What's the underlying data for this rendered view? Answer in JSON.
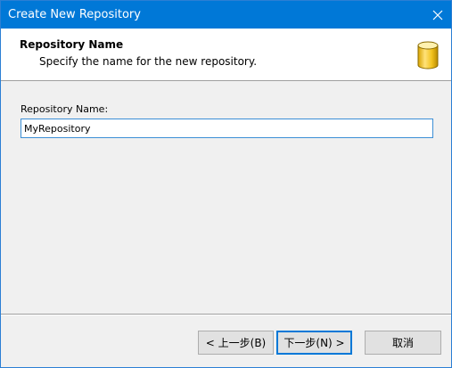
{
  "window": {
    "title": "Create New Repository",
    "title_bar_color": "#0078d7"
  },
  "header": {
    "title": "Repository Name",
    "subtitle": "Specify the name for the new repository.",
    "icon": "database-icon",
    "icon_color": "#f0c419"
  },
  "form": {
    "label": "Repository Name:",
    "value": "MyRepository"
  },
  "buttons": {
    "back": "< 上一步(B)",
    "next": "下一步(N) >",
    "cancel": "取消"
  }
}
